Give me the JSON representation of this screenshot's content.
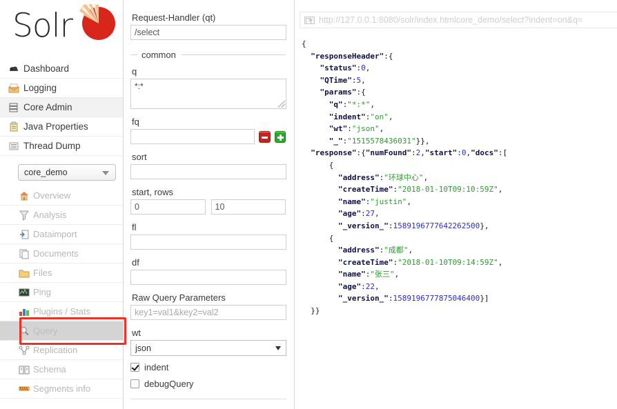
{
  "brand": {
    "name": "Solr",
    "logo_icon": "solr-sunburst-logo"
  },
  "sidebar": {
    "top_items": [
      {
        "label": "Dashboard",
        "icon": "dashboard-icon",
        "active": true
      },
      {
        "label": "Logging",
        "icon": "logging-icon",
        "active": false
      },
      {
        "label": "Core Admin",
        "icon": "core-admin-icon",
        "active": true
      },
      {
        "label": "Java Properties",
        "icon": "java-properties-icon",
        "active": false
      },
      {
        "label": "Thread Dump",
        "icon": "thread-dump-icon",
        "active": false
      }
    ],
    "core_selector": {
      "value": "core_demo",
      "caret_icon": "chevron-down-icon"
    },
    "sub_items": [
      {
        "label": "Overview",
        "icon": "overview-icon"
      },
      {
        "label": "Analysis",
        "icon": "analysis-icon"
      },
      {
        "label": "Dataimport",
        "icon": "dataimport-icon"
      },
      {
        "label": "Documents",
        "icon": "documents-icon"
      },
      {
        "label": "Files",
        "icon": "files-icon"
      },
      {
        "label": "Ping",
        "icon": "ping-icon"
      },
      {
        "label": "Plugins / Stats",
        "icon": "plugins-stats-icon"
      },
      {
        "label": "Query",
        "icon": "query-search-icon"
      },
      {
        "label": "Replication",
        "icon": "replication-icon"
      },
      {
        "label": "Schema",
        "icon": "schema-icon"
      },
      {
        "label": "Segments info",
        "icon": "segments-info-icon"
      }
    ],
    "selected_sub_item": "Query",
    "annotation_color": "#ee3124"
  },
  "query_form": {
    "request_handler": {
      "label": "Request-Handler (qt)",
      "value": "/select"
    },
    "common_legend": "common",
    "q": {
      "label": "q",
      "value": "*:*"
    },
    "fq": {
      "label": "fq",
      "value": "",
      "remove_icon": "minus-button",
      "add_icon": "plus-button"
    },
    "sort": {
      "label": "sort",
      "value": ""
    },
    "start_rows": {
      "label": "start, rows",
      "start": "0",
      "rows": "10"
    },
    "fl": {
      "label": "fl",
      "value": ""
    },
    "df": {
      "label": "df",
      "value": ""
    },
    "raw_query_parameters": {
      "label": "Raw Query Parameters",
      "placeholder": "key1=val1&key2=val2",
      "value": ""
    },
    "wt": {
      "label": "wt",
      "value": "json",
      "caret_icon": "chevron-down-icon"
    },
    "indent": {
      "label": "indent",
      "checked": true
    },
    "debug_query": {
      "label": "debugQuery",
      "checked": false
    }
  },
  "result": {
    "url_icon": "page-select-icon",
    "url": "http://127.0.0.1:8080/solr/index.htmlcore_demo/select?indent=on&q=",
    "response": {
      "responseHeader": {
        "status": 0,
        "QTime": 5,
        "params": {
          "q": "*:*",
          "indent": "on",
          "wt": "json",
          "_": "1515578436031"
        }
      },
      "response": {
        "numFound": 2,
        "start": 0,
        "docs": [
          {
            "address": "环球中心",
            "createTime": "2018-01-10T09:10:59Z",
            "name": "justin",
            "age": 27,
            "_version_": 1589196777642262528
          },
          {
            "address": "成都",
            "createTime": "2018-01-10T09:14:59Z",
            "name": "张三",
            "age": 22,
            "_version_": 1589196777875046400
          }
        ]
      }
    }
  },
  "colors": {
    "json_key": "#0f0f4a",
    "json_string": "#2e9a2e",
    "json_number": "#2b2bd6",
    "accent_red": "#ee3124",
    "add_green": "#2aa92a"
  }
}
